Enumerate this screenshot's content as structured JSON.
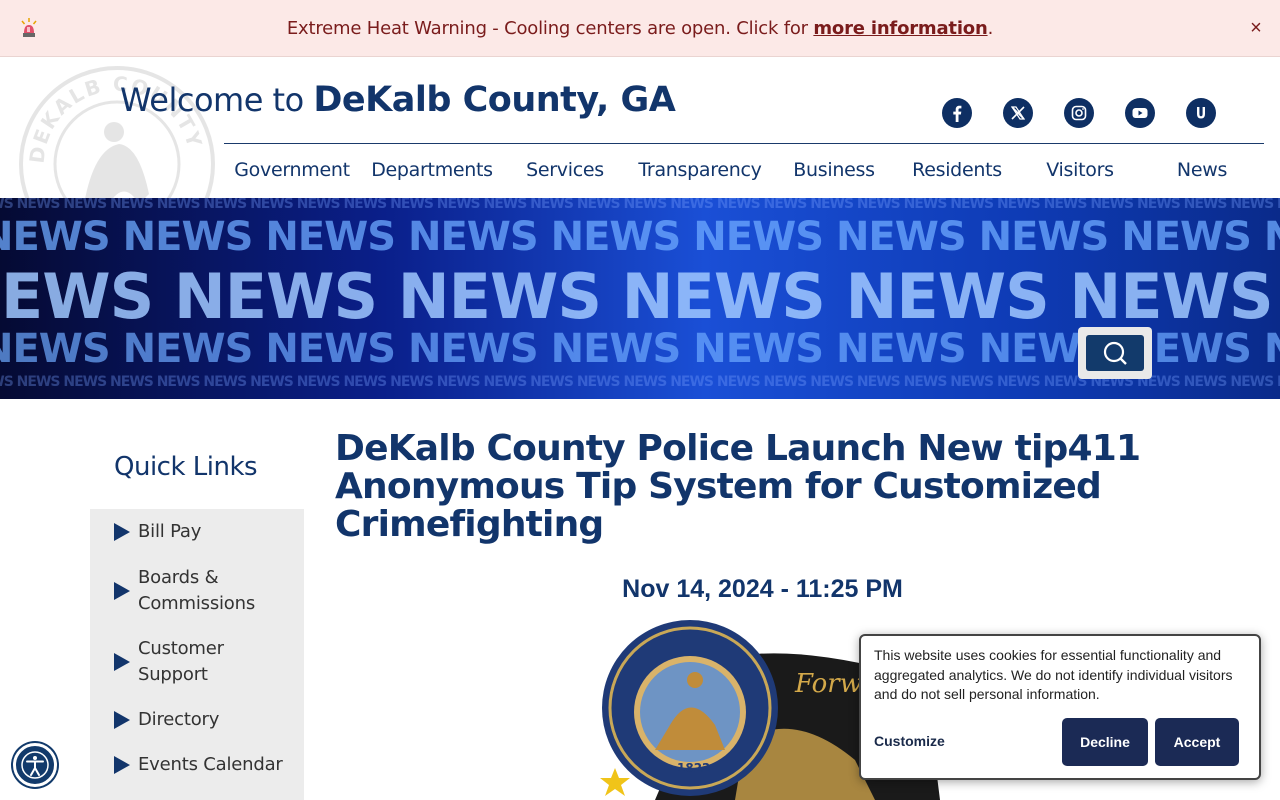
{
  "alert": {
    "text": "Extreme Heat Warning - Cooling centers are open. Click for ",
    "link": "more information",
    "suffix": ".",
    "close": "×"
  },
  "header": {
    "welcome_prefix": "Welcome to ",
    "county_name": "DeKalb County, GA",
    "seal_text": "DEKALB COUNTY GEORGIA",
    "social": [
      "facebook-icon",
      "x-icon",
      "instagram-icon",
      "youtube-icon",
      "u-icon"
    ]
  },
  "nav": {
    "items": [
      "Government",
      "Departments",
      "Services",
      "Transparency",
      "Business",
      "Residents",
      "Visitors",
      "News"
    ]
  },
  "banner": {
    "word": "NEWS"
  },
  "sidebar": {
    "title": "Quick Links",
    "items": [
      {
        "label": "Bill Pay"
      },
      {
        "label": "Boards & Commissions"
      },
      {
        "label": "Customer Support"
      },
      {
        "label": "Directory"
      },
      {
        "label": "Events Calendar"
      }
    ]
  },
  "article": {
    "title": "DeKalb County Police Launch New tip411 Anonymous Tip System for Customized Crimefighting",
    "date": "Nov 14, 2024 - 11:25 PM"
  },
  "cookie": {
    "text": "This website uses cookies for essential functionality and aggregated analytics. We do not identify individual visitors and do not sell personal information.",
    "customize": "Customize",
    "decline": "Decline",
    "accept": "Accept"
  },
  "colors": {
    "brand": "#12356b",
    "alert_bg": "#fce9e7",
    "alert_text": "#7a1c1c",
    "sidebar_bg": "#ececec",
    "button": "#1b2a55"
  }
}
